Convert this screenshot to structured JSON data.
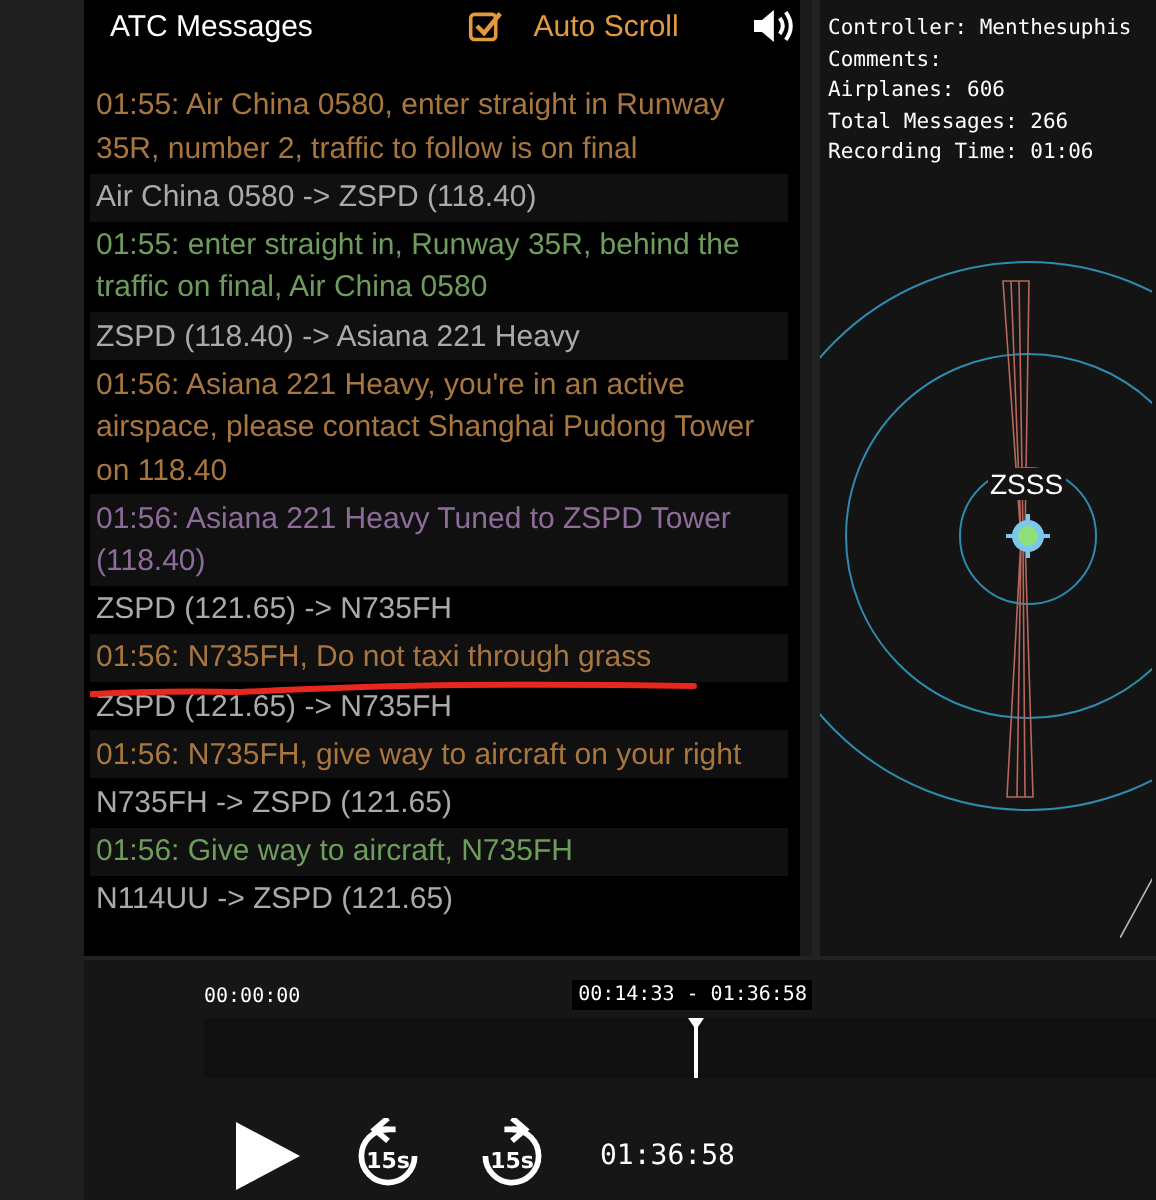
{
  "messages_panel": {
    "title": "ATC Messages",
    "auto_scroll": {
      "label": "Auto Scroll",
      "checked": true
    },
    "messages": [
      {
        "kind": "atc",
        "text": "01:55: Air China 0580, enter straight in Runway 35R, number 2, traffic to follow is on final"
      },
      {
        "kind": "route",
        "text": "Air China 0580 -> ZSPD (118.40)"
      },
      {
        "kind": "pilot",
        "text": "01:55: enter straight in, Runway 35R, behind the traffic on final, Air China 0580"
      },
      {
        "kind": "route",
        "text": "ZSPD (118.40) -> Asiana 221 Heavy"
      },
      {
        "kind": "atc",
        "text": "01:56: Asiana 221 Heavy, you're in an active airspace,  please contact Shanghai Pudong Tower on 118.40"
      },
      {
        "kind": "system",
        "text": "01:56: Asiana 221 Heavy Tuned to ZSPD Tower (118.40)"
      },
      {
        "kind": "route",
        "text": "ZSPD (121.65) -> N735FH"
      },
      {
        "kind": "atc",
        "text": "01:56: N735FH, Do not taxi through grass"
      },
      {
        "kind": "route",
        "text": "ZSPD (121.65) -> N735FH"
      },
      {
        "kind": "atc",
        "text": "01:56: N735FH, give way to aircraft on your right"
      },
      {
        "kind": "route",
        "text": "N735FH -> ZSPD (121.65)"
      },
      {
        "kind": "pilot",
        "text": "01:56: Give way to aircraft, N735FH"
      },
      {
        "kind": "route",
        "text": "N114UU -> ZSPD (121.65)"
      }
    ]
  },
  "recording_info": [
    "Controller: Menthesuphis",
    "Comments:",
    "Airplanes: 606",
    "Total Messages: 266",
    "Recording Time: 01:06"
  ],
  "radar": {
    "airport": "ZSSS"
  },
  "player": {
    "start_time": "00:00:00",
    "range_label": "00:14:33 - 01:36:58",
    "playhead": {
      "level": 0.517
    },
    "back_label": "15s",
    "forward_label": "15s",
    "duration": "01:36:58"
  }
}
